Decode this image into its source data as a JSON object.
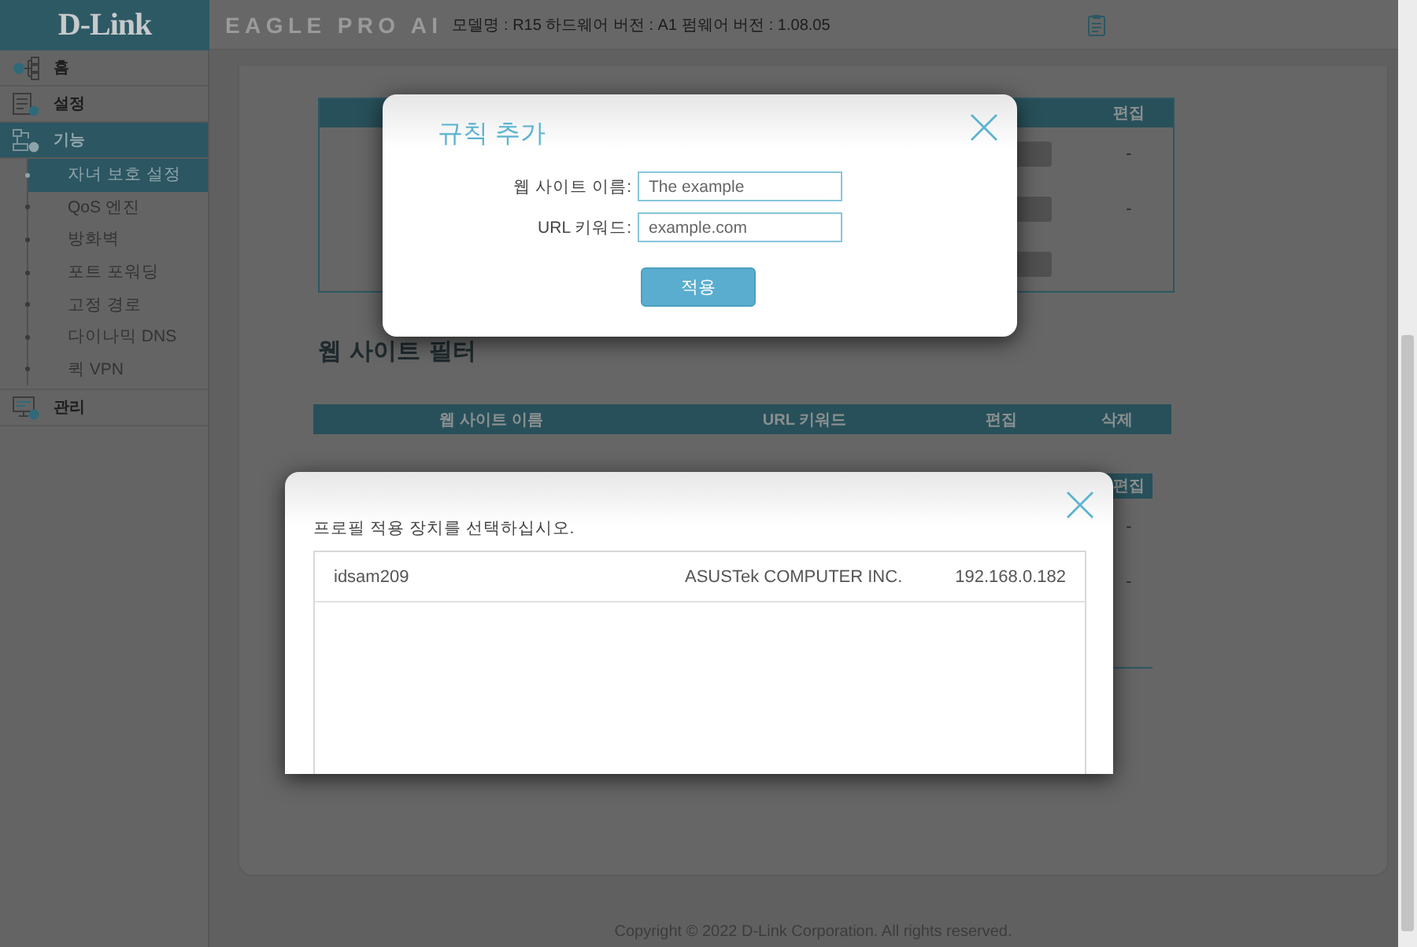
{
  "sidebar": {
    "logo": "D-Link",
    "items": [
      {
        "label": "홈",
        "selected": false
      },
      {
        "label": "설정",
        "selected": false
      },
      {
        "label": "기능",
        "selected": true,
        "expanded": true,
        "children": [
          {
            "label": "자녀 보호 설정",
            "selected": true
          },
          {
            "label": "QoS 엔진",
            "selected": false
          },
          {
            "label": "방화벽",
            "selected": false
          },
          {
            "label": "포트 포워딩",
            "selected": false
          },
          {
            "label": "고정 경로",
            "selected": false
          },
          {
            "label": "다이나믹 DNS",
            "selected": false
          },
          {
            "label": "퀵 VPN",
            "selected": false
          }
        ]
      },
      {
        "label": "관리",
        "selected": false
      }
    ]
  },
  "header": {
    "brand": "EAGLE PRO AI",
    "device_info": "모델명 : R15 하드웨어 버전 : A1 펌웨어 버전 : 1.08.05"
  },
  "rules_table": {
    "columns": [
      {
        "label": "편집"
      }
    ],
    "rows": [
      {
        "edit": "-"
      },
      {
        "edit": "-"
      },
      {}
    ]
  },
  "website_filter": {
    "title": "웹 사이트 필터",
    "columns": [
      {
        "label": "웹 사이트 이름"
      },
      {
        "label": "URL 키워드"
      },
      {
        "label": "편집"
      },
      {
        "label": "삭제"
      }
    ]
  },
  "device_table": {
    "columns": [
      {
        "label": "편집"
      }
    ],
    "rows": [
      {
        "edit": "-"
      },
      {
        "edit": "-"
      }
    ]
  },
  "footer": {
    "copyright": "Copyright © 2022 D-Link Corporation. All rights reserved."
  },
  "add_rule_dialog": {
    "title": "규칙 추가",
    "fields": [
      {
        "label": "웹 사이트 이름:",
        "value": "The example"
      },
      {
        "label": "URL 키워드:",
        "value": "example.com"
      }
    ],
    "button": "적용"
  },
  "device_dialog": {
    "prompt": "프로필 적용 장치를 선택하십시오.",
    "devices": [
      {
        "name": "idsam209",
        "vendor": "ASUSTek COMPUTER INC.",
        "ip": "192.168.0.182",
        "selected": false
      }
    ]
  }
}
